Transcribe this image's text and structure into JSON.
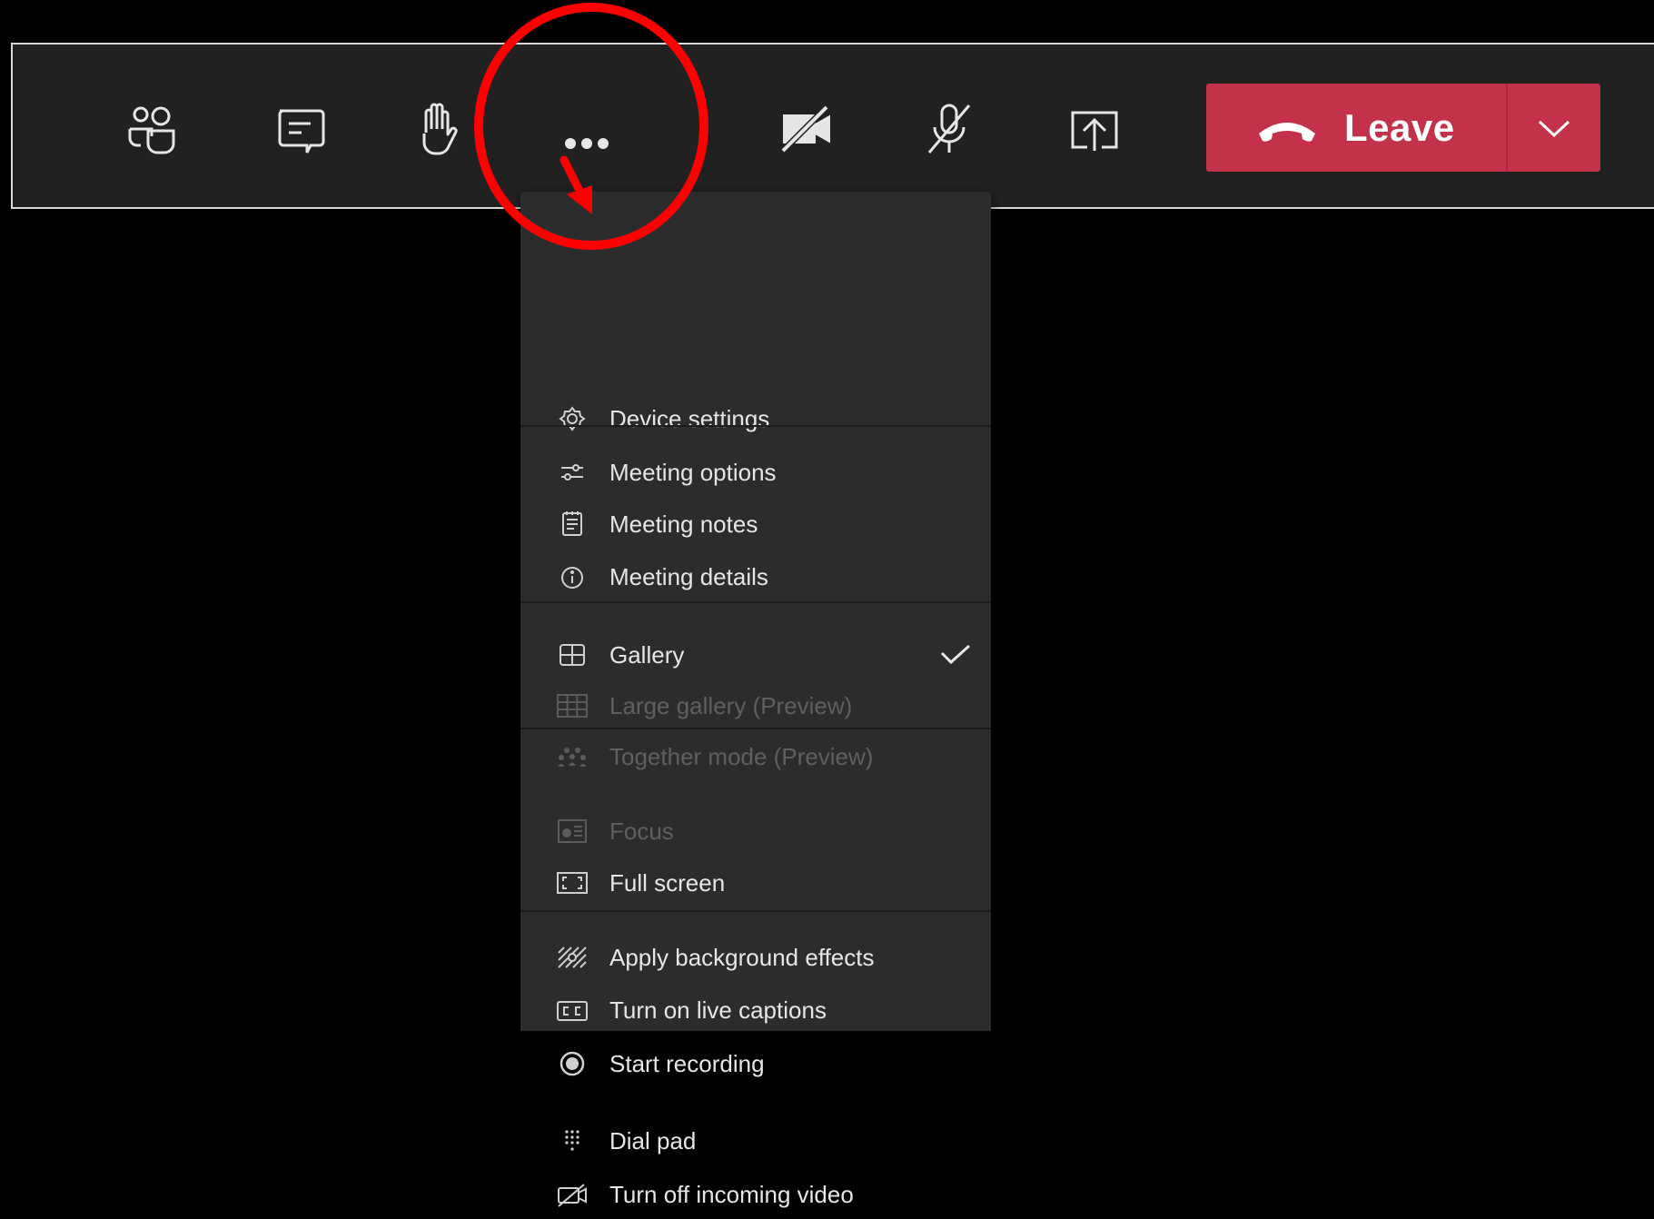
{
  "toolbar": {
    "buttons": [
      {
        "name": "participants-icon"
      },
      {
        "name": "chat-icon"
      },
      {
        "name": "raise-hand-icon"
      },
      {
        "name": "more-actions-icon"
      },
      {
        "name": "camera-off-icon"
      },
      {
        "name": "microphone-muted-icon"
      },
      {
        "name": "share-screen-icon"
      }
    ],
    "leave": {
      "label": "Leave",
      "color": "#c4314b"
    }
  },
  "menu": {
    "items": [
      {
        "label": "Device settings",
        "icon": "gear-icon",
        "enabled": true
      },
      {
        "label": "Meeting options",
        "icon": "sliders-icon",
        "enabled": true
      },
      {
        "label": "Meeting notes",
        "icon": "notes-icon",
        "enabled": true
      },
      {
        "label": "Meeting details",
        "icon": "info-icon",
        "enabled": true
      },
      {
        "label": "Gallery",
        "icon": "gallery-icon",
        "enabled": true,
        "checked": true
      },
      {
        "label": "Large gallery (Preview)",
        "icon": "large-gallery-icon",
        "enabled": false
      },
      {
        "label": "Together mode (Preview)",
        "icon": "together-mode-icon",
        "enabled": false
      },
      {
        "label": "Focus",
        "icon": "focus-icon",
        "enabled": false
      },
      {
        "label": "Full screen",
        "icon": "fullscreen-icon",
        "enabled": true
      },
      {
        "label": "Apply background effects",
        "icon": "background-effects-icon",
        "enabled": true
      },
      {
        "label": "Turn on live captions",
        "icon": "captions-icon",
        "enabled": true
      },
      {
        "label": "Start recording",
        "icon": "record-icon",
        "enabled": true
      },
      {
        "label": "Dial pad",
        "icon": "dialpad-icon",
        "enabled": true
      },
      {
        "label": "Turn off incoming video",
        "icon": "incoming-video-off-icon",
        "enabled": true
      }
    ]
  },
  "annotation": {
    "color": "#ff0000"
  }
}
